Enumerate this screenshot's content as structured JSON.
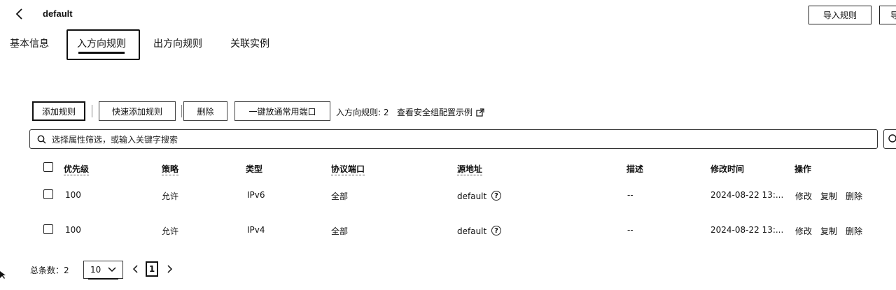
{
  "header": {
    "back_icon": "chevron-left-icon",
    "title": "default",
    "import_button": "导入规则",
    "cut_button": "导"
  },
  "tabs": [
    {
      "label": "基本信息",
      "active": false
    },
    {
      "label": "入方向规则",
      "active": true
    },
    {
      "label": "出方向规则",
      "active": false
    },
    {
      "label": "关联实例",
      "active": false
    }
  ],
  "toolbar": {
    "add_rule": "添加规则",
    "quick_add": "快速添加规则",
    "delete": "删除",
    "open_ports": "一键放通常用端口",
    "rule_count": "入方向规则: 2",
    "example_link": "查看安全组配置示例"
  },
  "search": {
    "placeholder": "选择属性筛选，或输入关键字搜索"
  },
  "table": {
    "headers": {
      "priority": "优先级",
      "policy": "策略",
      "type": "类型",
      "port": "协议端口",
      "source": "源地址",
      "desc": "描述",
      "modified": "修改时间",
      "actions": "操作"
    },
    "rows": [
      {
        "priority": "100",
        "policy": "允许",
        "type": "IPv6",
        "port": "全部",
        "source": "default",
        "desc": "--",
        "modified": "2024-08-22 13:...",
        "edit": "修改",
        "copy": "复制",
        "delete": "删除"
      },
      {
        "priority": "100",
        "policy": "允许",
        "type": "IPv4",
        "port": "全部",
        "source": "default",
        "desc": "--",
        "modified": "2024-08-22 13:...",
        "edit": "修改",
        "copy": "复制",
        "delete": "删除"
      }
    ]
  },
  "pagination": {
    "total": "总条数：2",
    "page_size": "10",
    "current_page": "1"
  }
}
